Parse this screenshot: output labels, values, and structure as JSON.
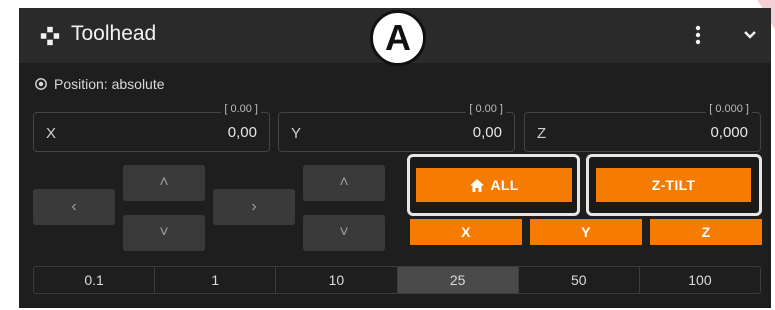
{
  "header": {
    "title": "Toolhead",
    "title_icon": "move-icon",
    "more_icon": "more-vert-icon",
    "collapse_icon": "chevron-down-icon"
  },
  "annotation": {
    "label": "A"
  },
  "position": {
    "icon": "crosshair-icon",
    "label": "Position: absolute"
  },
  "fields": [
    {
      "axis": "X",
      "value": "0,00",
      "hint": "[ 0.00 ]"
    },
    {
      "axis": "Y",
      "value": "0,00",
      "hint": "[ 0.00 ]"
    },
    {
      "axis": "Z",
      "value": "0,000",
      "hint": "[ 0.000 ]"
    }
  ],
  "jog": {
    "left": "‹",
    "right": "›",
    "up": "˄",
    "down": "˅"
  },
  "home": {
    "all_label": "ALL",
    "all_icon": "home-icon",
    "ztilt_label": "Z-TILT",
    "x_label": "X",
    "y_label": "Y",
    "z_label": "Z"
  },
  "steps": {
    "values": [
      "0.1",
      "1",
      "10",
      "25",
      "50",
      "100"
    ],
    "active": "25"
  },
  "colors": {
    "accent": "#f57c00",
    "panel": "#1e1e1e",
    "header": "#2a2a2a"
  }
}
